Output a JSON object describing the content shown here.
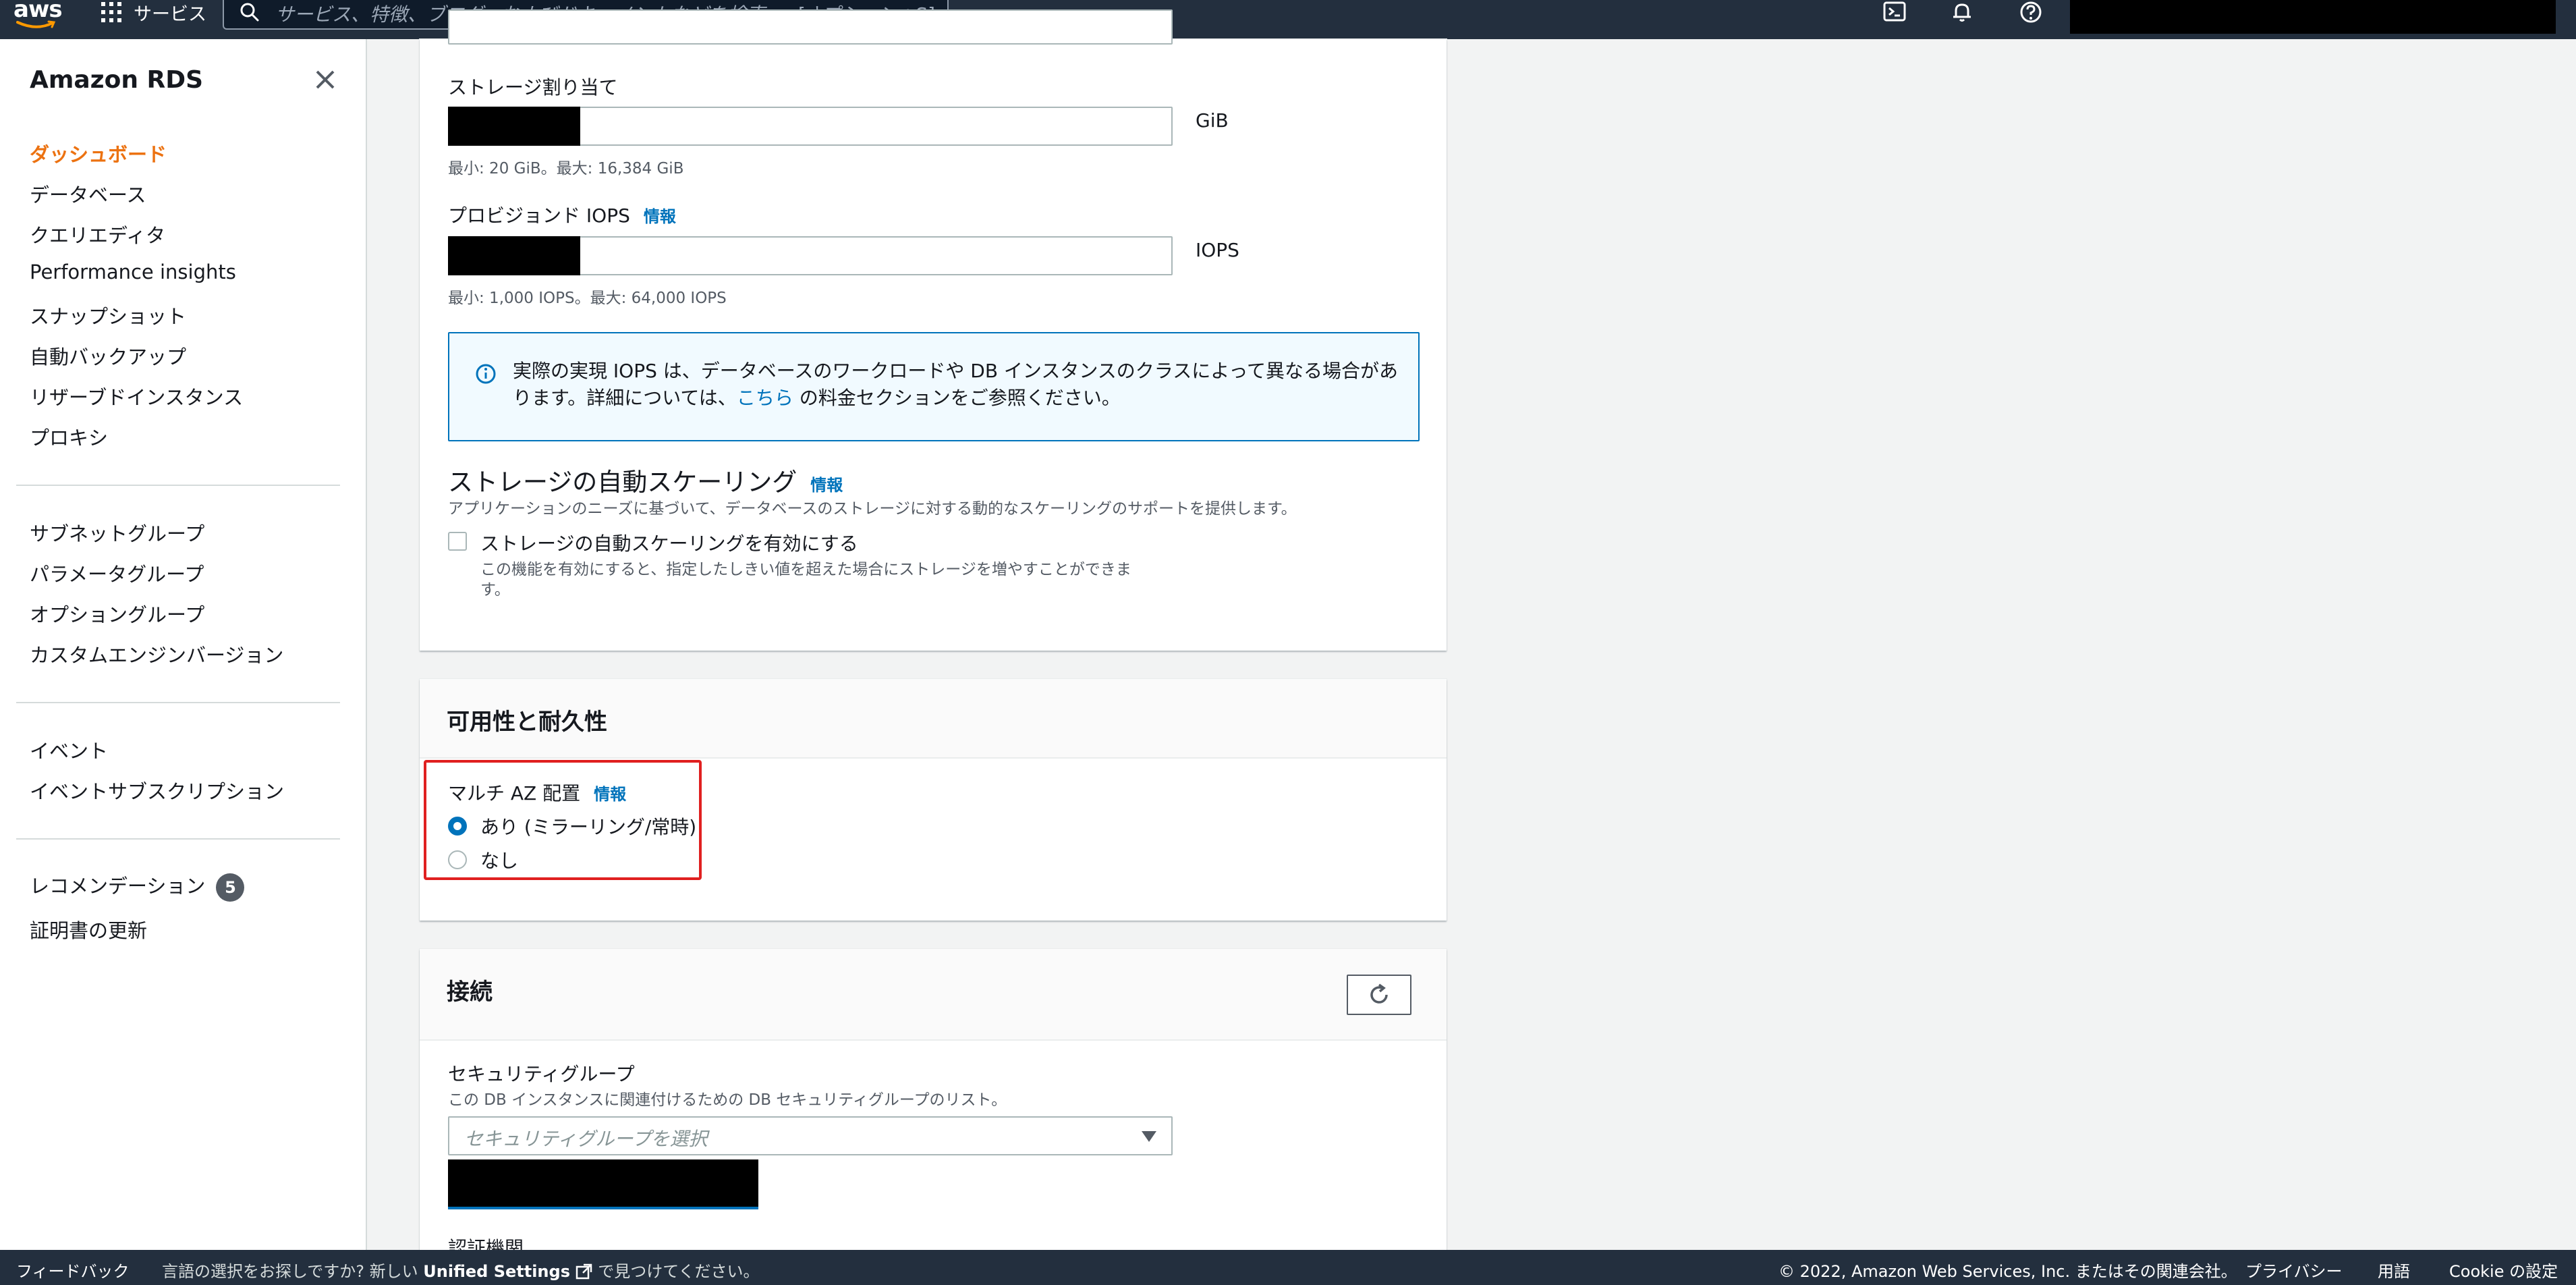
{
  "topnav": {
    "logo_text": "aws",
    "services_label": "サービス",
    "search_placeholder": "サービス、特徴、ブログ、およびドキュメントなどを検索",
    "search_shortcut": "[オプション+S]"
  },
  "sidebar": {
    "title": "Amazon RDS",
    "items": [
      {
        "label": "ダッシュボード"
      },
      {
        "label": "データベース"
      },
      {
        "label": "クエリエディタ"
      },
      {
        "label": "Performance insights"
      },
      {
        "label": "スナップショット"
      },
      {
        "label": "自動バックアップ"
      },
      {
        "label": "リザーブドインスタンス"
      },
      {
        "label": "プロキシ"
      },
      {
        "label": "サブネットグループ"
      },
      {
        "label": "パラメータグループ"
      },
      {
        "label": "オプショングループ"
      },
      {
        "label": "カスタムエンジンバージョン"
      },
      {
        "label": "イベント"
      },
      {
        "label": "イベントサブスクリプション"
      },
      {
        "label": "レコメンデーション",
        "badge": "5"
      },
      {
        "label": "証明書の更新"
      }
    ]
  },
  "storage": {
    "allocation_label": "ストレージ割り当て",
    "allocation_unit": "GiB",
    "allocation_hint": "最小: 20 GiB。最大: 16,384 GiB",
    "iops_label": "プロビジョンド IOPS",
    "iops_info": "情報",
    "iops_unit": "IOPS",
    "iops_hint": "最小: 1,000 IOPS。最大: 64,000 IOPS",
    "alert_text_1": "実際の実現 IOPS は、データベースのワークロードや DB インスタンスのクラスによって異なる場合があります。詳細については、",
    "alert_link": "こちら",
    "alert_text_2": " の料金セクションをご参照ください。",
    "autoscaling_title": "ストレージの自動スケーリング",
    "autoscaling_info": "情報",
    "autoscaling_desc": "アプリケーションのニーズに基づいて、データベースのストレージに対する動的なスケーリングのサポートを提供します。",
    "autoscaling_checkbox_label": "ストレージの自動スケーリングを有効にする",
    "autoscaling_checkbox_desc_1": "この機能を有効にすると、指定したしきい値を超えた場合にストレージを増やすことができま",
    "autoscaling_checkbox_desc_2": "す。"
  },
  "availability": {
    "title": "可用性と耐久性",
    "multi_az_label": "マルチ AZ 配置",
    "multi_az_info": "情報",
    "option_yes": "あり (ミラーリング/常時)",
    "option_no": "なし",
    "selected": "option_yes"
  },
  "connectivity": {
    "title": "接続",
    "security_group_label": "セキュリティグループ",
    "security_group_desc": "この DB インスタンスに関連付けるための DB セキュリティグループのリスト。",
    "security_group_placeholder": "セキュリティグループを選択",
    "auth_label": "認証機関"
  },
  "footer": {
    "feedback": "フィードバック",
    "lang_prefix": "言語の選択をお探しですか? 新しい",
    "unified_settings": "Unified Settings",
    "lang_suffix": "で見つけてください。",
    "copyright": "© 2022, Amazon Web Services, Inc. またはその関連会社。",
    "privacy": "プライバシー",
    "terms": "用語",
    "cookie": "Cookie の設定"
  },
  "colors": {
    "nav_bg": "#232f3e",
    "accent_orange": "#ec7211",
    "link_blue": "#0073bb",
    "highlight_red": "#e02020"
  }
}
